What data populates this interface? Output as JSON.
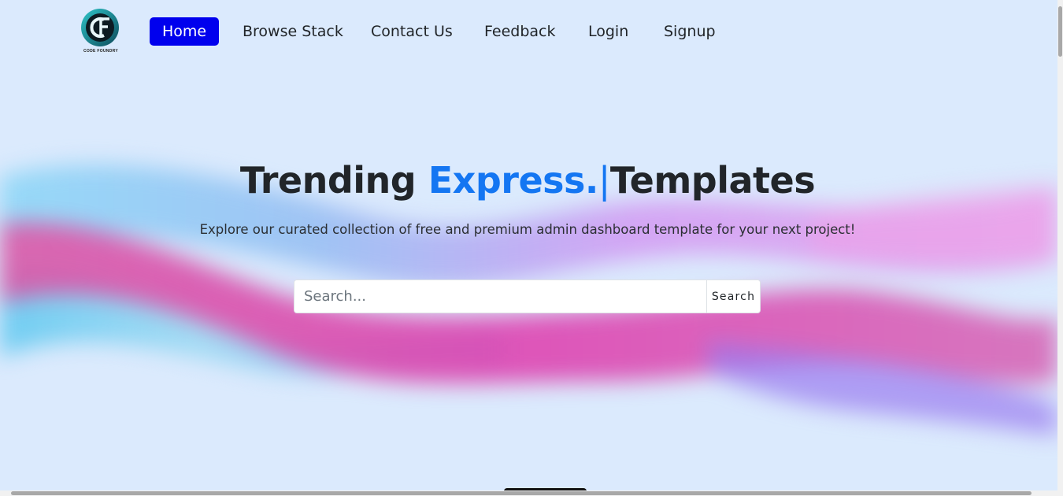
{
  "brand": {
    "logo_initials": "CF",
    "logo_text": "CODE FOUNDRY"
  },
  "nav": {
    "items": [
      {
        "label": "Home",
        "active": true
      },
      {
        "label": "Browse Stack"
      },
      {
        "label": "Contact Us"
      },
      {
        "label": "Feedback"
      },
      {
        "label": "Login"
      },
      {
        "label": "Signup"
      }
    ]
  },
  "hero": {
    "title_prefix": "Trending ",
    "title_accent": "Express.",
    "title_caret": "|",
    "title_suffix": "Templates",
    "subtitle": "Explore our curated collection of free and premium admin dashboard template for your next project!"
  },
  "search": {
    "placeholder": "Search...",
    "button_label": "Search"
  },
  "colors": {
    "background": "#dbeafd",
    "active_nav": "#0000ee",
    "accent": "#1476f2"
  },
  "icons": {
    "logo": "code-foundry-logo-icon"
  }
}
